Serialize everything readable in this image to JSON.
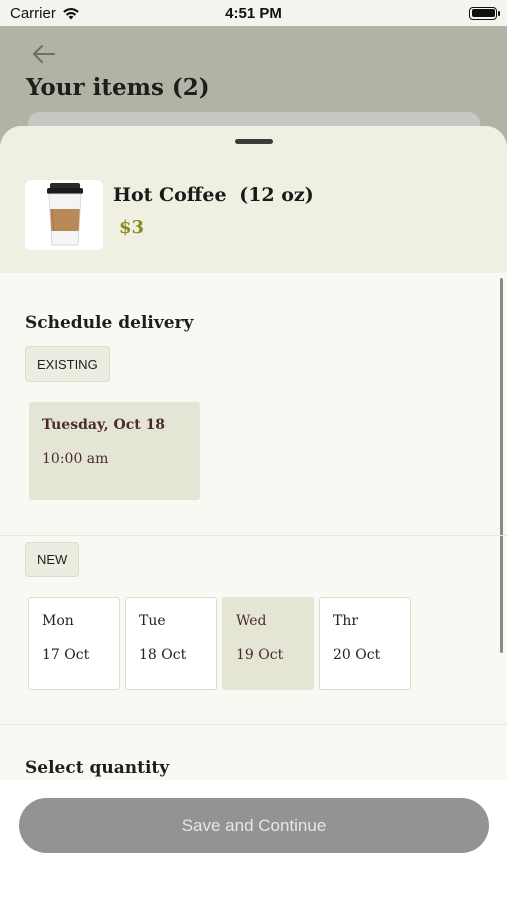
{
  "status_bar": {
    "carrier": "Carrier",
    "time": "4:51 PM"
  },
  "background_page": {
    "title": "Your items (2)"
  },
  "product": {
    "name": "Hot Coffee",
    "size": "(12 oz)",
    "price": "$3"
  },
  "schedule": {
    "title": "Schedule delivery",
    "existing_tag": "EXISTING",
    "existing_slot": {
      "date": "Tuesday, Oct 18",
      "time": "10:00 am"
    },
    "new_tag": "NEW",
    "days": [
      {
        "name": "Mon",
        "date": "17 Oct",
        "selected": false
      },
      {
        "name": "Tue",
        "date": "18 Oct",
        "selected": false
      },
      {
        "name": "Wed",
        "date": "19 Oct",
        "selected": true
      },
      {
        "name": "Thr",
        "date": "20 Oct",
        "selected": false
      }
    ]
  },
  "quantity": {
    "title": "Select quantity"
  },
  "footer": {
    "save_label": "Save and Continue"
  },
  "colors": {
    "price": "#8b8a1f",
    "selected_day_bg": "#e5e5d6",
    "save_button_bg": "#939393",
    "header_bg": "#f0f0e2"
  }
}
